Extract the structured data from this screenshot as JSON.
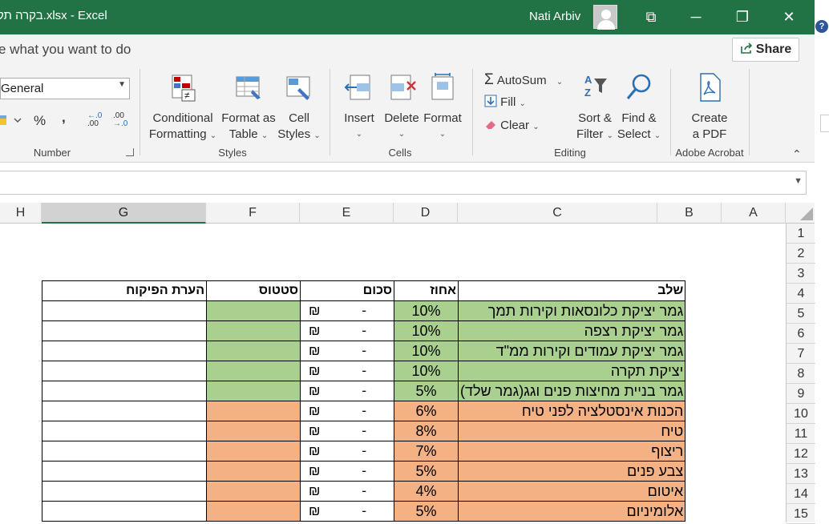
{
  "window": {
    "doc_title": "בקרה תק.xlsx  -  Excel",
    "user_name": "Nati Arbiv",
    "controls": {
      "restore_down": "⧉",
      "minimize": "─",
      "maximize": "❐",
      "close": "✕"
    },
    "help": "?"
  },
  "ribbon": {
    "tell_me": "e what you want to do",
    "share_label": "Share",
    "number": {
      "format_value": "General",
      "percent": "%",
      "comma": ",",
      "increase_decimal": ".00",
      "decrease_decimal": ".0",
      "group_label": "Number"
    },
    "styles": {
      "conditional_formatting": [
        "Conditional",
        "Formatting"
      ],
      "format_as_table": [
        "Format as",
        "Table"
      ],
      "cell_styles": [
        "Cell",
        "Styles"
      ],
      "group_label": "Styles"
    },
    "cells": {
      "insert": "Insert",
      "delete": "Delete",
      "format": "Format",
      "group_label": "Cells"
    },
    "editing": {
      "autosum": "AutoSum",
      "fill": "Fill",
      "clear": "Clear",
      "sort_filter": [
        "Sort &",
        "Filter"
      ],
      "find_select": [
        "Find &",
        "Select"
      ],
      "group_label": "Editing"
    },
    "adobe": {
      "create_pdf": [
        "Create",
        "a PDF"
      ],
      "group_label": "Adobe Acrobat"
    }
  },
  "columns": [
    "H",
    "G",
    "F",
    "E",
    "D",
    "C",
    "B",
    "A"
  ],
  "rows": [
    "1",
    "2",
    "3",
    "4",
    "5",
    "6",
    "7",
    "8",
    "9",
    "10",
    "11",
    "12",
    "13",
    "14",
    "15"
  ],
  "table": {
    "headers": {
      "G": "הערת הפיקוח",
      "F": "סטטוס",
      "E": "סכום",
      "D": "אחוז",
      "C": "שלב"
    },
    "rows": [
      {
        "stage": "גמר יציקת כלונסאות וקירות תמך",
        "pct": "10%",
        "currency": "₪",
        "amount": "-",
        "status": "green"
      },
      {
        "stage": "גמר יציקת רצפה",
        "pct": "10%",
        "currency": "₪",
        "amount": "-",
        "status": "green"
      },
      {
        "stage": "גמר יציקת עמודים וקירות ממ\"ד",
        "pct": "10%",
        "currency": "₪",
        "amount": "-",
        "status": "green"
      },
      {
        "stage": " יציקת תקרה",
        "pct": "10%",
        "currency": "₪",
        "amount": "-",
        "status": "green"
      },
      {
        "stage": "גמר בניית מחיצות פנים וגג(גמר שלד)",
        "pct": "5%",
        "currency": "₪",
        "amount": "-",
        "status": "green"
      },
      {
        "stage": "הכנות אינסטלציה לפני טיח",
        "pct": "6%",
        "currency": "₪",
        "amount": "-",
        "status": "orange"
      },
      {
        "stage": "טיח",
        "pct": "8%",
        "currency": "₪",
        "amount": "-",
        "status": "orange"
      },
      {
        "stage": "ריצוף",
        "pct": "7%",
        "currency": "₪",
        "amount": "-",
        "status": "orange"
      },
      {
        "stage": "צבע פנים",
        "pct": "5%",
        "currency": "₪",
        "amount": "-",
        "status": "orange"
      },
      {
        "stage": "איטום",
        "pct": "4%",
        "currency": "₪",
        "amount": "-",
        "status": "orange"
      },
      {
        "stage": "אלומיניום",
        "pct": "5%",
        "currency": "₪",
        "amount": "-",
        "status": "orange"
      }
    ]
  },
  "colors": {
    "title_green": "#217346",
    "status_green": "#a9d08e",
    "status_orange": "#f4b183"
  }
}
